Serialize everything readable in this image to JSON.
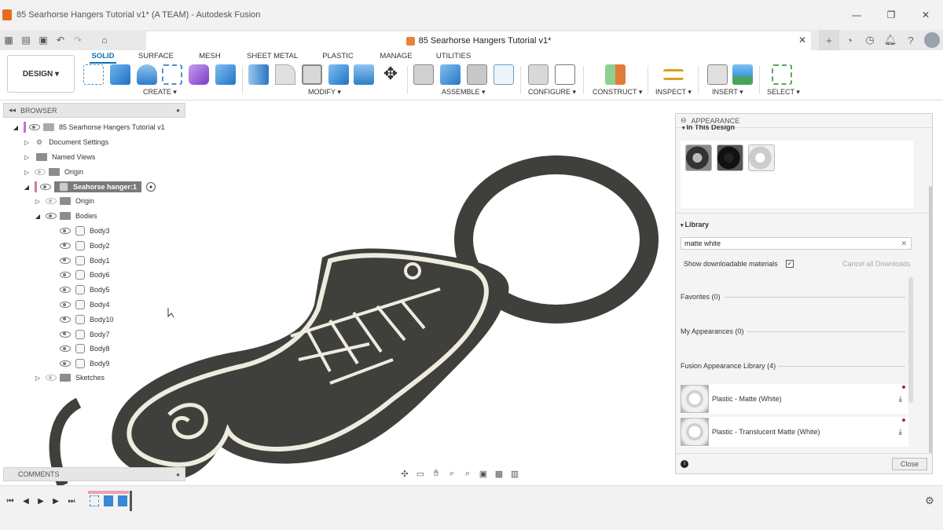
{
  "window": {
    "title": "85 Searhorse Hangers Tutorial v1* (A TEAM) - Autodesk Fusion",
    "minimize": "—",
    "maximize": "❐",
    "close": "✕"
  },
  "document_tab": {
    "label": "85 Searhorse Hangers Tutorial v1*",
    "close": "✕"
  },
  "workspace_button": "DESIGN ▾",
  "ribbon_tabs": [
    "SOLID",
    "SURFACE",
    "MESH",
    "SHEET METAL",
    "PLASTIC",
    "MANAGE",
    "UTILITIES"
  ],
  "ribbon_active_tab": "SOLID",
  "ribbon_groups": {
    "create": "CREATE ▾",
    "modify": "MODIFY ▾",
    "assemble": "ASSEMBLE ▾",
    "configure": "CONFIGURE ▾",
    "construct": "CONSTRUCT ▾",
    "inspect": "INSPECT ▾",
    "insert": "INSERT ▾",
    "select": "SELECT ▾"
  },
  "browser": {
    "title": "BROWSER",
    "root": "85 Searhorse Hangers Tutorial v1",
    "items": {
      "document_settings": "Document Settings",
      "named_views": "Named Views",
      "origin_top": "Origin",
      "component": "Seahorse hanger:1",
      "origin_component": "Origin",
      "bodies": "Bodies",
      "sketches": "Sketches"
    },
    "bodies_list": [
      "Body3",
      "Body2",
      "Body1",
      "Body6",
      "Body5",
      "Body4",
      "Body10",
      "Body7",
      "Body8",
      "Body9"
    ]
  },
  "comments": {
    "title": "COMMENTS"
  },
  "appearance": {
    "title": "APPEARANCE",
    "in_this_design": "In This Design",
    "library_title": "Library",
    "search_value": "matte white",
    "show_downloadable": "Show downloadable materials",
    "show_downloadable_checked": true,
    "cancel_downloads": "Cancel all Downloads",
    "favorites": "Favorites (0)",
    "my_appearances": "My Appearances (0)",
    "fusion_library": "Fusion Appearance Library (4)",
    "results": [
      "Plastic - Matte (White)",
      "Plastic - Translucent Matte (White)"
    ],
    "close_button": "Close"
  },
  "colors": {
    "accent": "#0e6fb9",
    "model_dark": "#3f403c",
    "model_white": "#efebdf"
  }
}
